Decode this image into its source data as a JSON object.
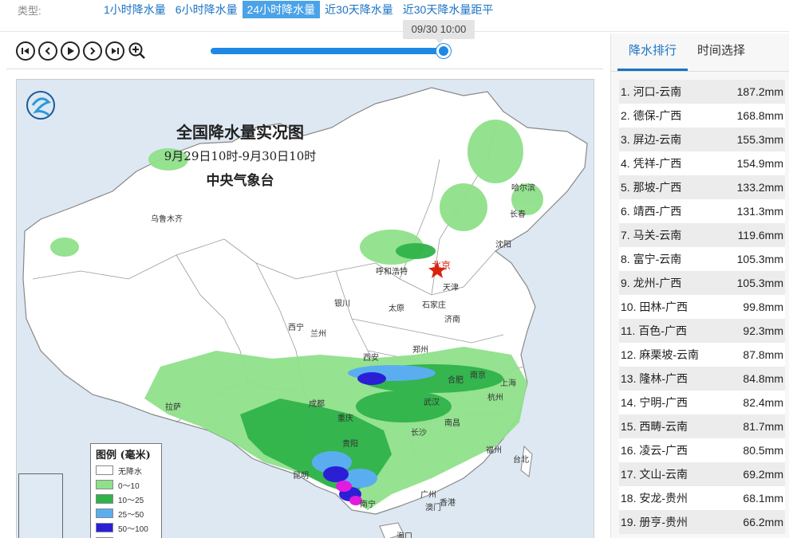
{
  "typebar": {
    "label": "类型:",
    "tabs": [
      {
        "label": "1小时降水量",
        "active": false
      },
      {
        "label": "6小时降水量",
        "active": false
      },
      {
        "label": "24小时降水量",
        "active": true
      },
      {
        "label": "近30天降水量",
        "active": false
      },
      {
        "label": "近30天降水量距平",
        "active": false
      }
    ]
  },
  "player": {
    "buttons": [
      "skip-to-start-icon",
      "previous-icon",
      "play-icon",
      "next-icon",
      "skip-to-end-icon",
      "zoom-in-icon"
    ],
    "slider_progress": 1.0,
    "time_tip": "09/30 10:00"
  },
  "map": {
    "title": "全国降水量实况图",
    "period": "9月29日10时-9月30日10时",
    "issuer": "中央气象台",
    "cities": {
      "wulumuqi": "乌鲁木齐",
      "haerbin": "哈尔滨",
      "changchun": "长春",
      "shenyang": "沈阳",
      "beijing": "北京",
      "tianjin": "天津",
      "huhehaote": "呼和浩特",
      "yinchuan": "银川",
      "taiyuan": "太原",
      "shijiazhuang": "石家庄",
      "jinan": "济南",
      "xining": "西宁",
      "lanzhou": "兰州",
      "xian": "西安",
      "zhengzhou": "郑州",
      "hefei": "合肥",
      "nanjing": "南京",
      "shanghai": "上海",
      "wuhan": "武汉",
      "hangzhou": "杭州",
      "lasa": "拉萨",
      "chengdu": "成都",
      "chongqing": "重庆",
      "nanchang": "南昌",
      "changsha": "长沙",
      "fuzhou": "福州",
      "taibei": "台北",
      "guiyang": "贵阳",
      "kunming": "昆明",
      "nanning": "南宁",
      "guangzhou": "广州",
      "aomen": "澳门",
      "xianggang": "香港",
      "haikou": "海口"
    },
    "legend": {
      "title": "图例 (毫米)",
      "items": [
        {
          "label": "无降水",
          "color": "#ffffff"
        },
        {
          "label": "0～10",
          "color": "#8fe08a"
        },
        {
          "label": "10～25",
          "color": "#2fb34a"
        },
        {
          "label": "25～50",
          "color": "#5aaef0"
        },
        {
          "label": "50～100",
          "color": "#2b1fd6"
        },
        {
          "label": "",
          "color": "#e21be0"
        }
      ]
    }
  },
  "panel": {
    "tabs": [
      {
        "label": "降水排行",
        "active": true
      },
      {
        "label": "时间选择",
        "active": false
      }
    ],
    "ranking": [
      {
        "name": "1. 河口-云南",
        "value": "187.2mm"
      },
      {
        "name": "2. 德保-广西",
        "value": "168.8mm"
      },
      {
        "name": "3. 屏边-云南",
        "value": "155.3mm"
      },
      {
        "name": "4. 凭祥-广西",
        "value": "154.9mm"
      },
      {
        "name": "5. 那坡-广西",
        "value": "133.2mm"
      },
      {
        "name": "6. 靖西-广西",
        "value": "131.3mm"
      },
      {
        "name": "7. 马关-云南",
        "value": "119.6mm"
      },
      {
        "name": "8. 富宁-云南",
        "value": "105.3mm"
      },
      {
        "name": "9. 龙州-广西",
        "value": "105.3mm"
      },
      {
        "name": "10. 田林-广西",
        "value": "99.8mm"
      },
      {
        "name": "11. 百色-广西",
        "value": "92.3mm"
      },
      {
        "name": "12. 麻栗坡-云南",
        "value": "87.8mm"
      },
      {
        "name": "13. 隆林-广西",
        "value": "84.8mm"
      },
      {
        "name": "14. 宁明-广西",
        "value": "82.4mm"
      },
      {
        "name": "15. 西畴-云南",
        "value": "81.7mm"
      },
      {
        "name": "16. 凌云-广西",
        "value": "80.5mm"
      },
      {
        "name": "17. 文山-云南",
        "value": "69.2mm"
      },
      {
        "name": "18. 安龙-贵州",
        "value": "68.1mm"
      },
      {
        "name": "19. 册亨-贵州",
        "value": "66.2mm"
      }
    ]
  }
}
